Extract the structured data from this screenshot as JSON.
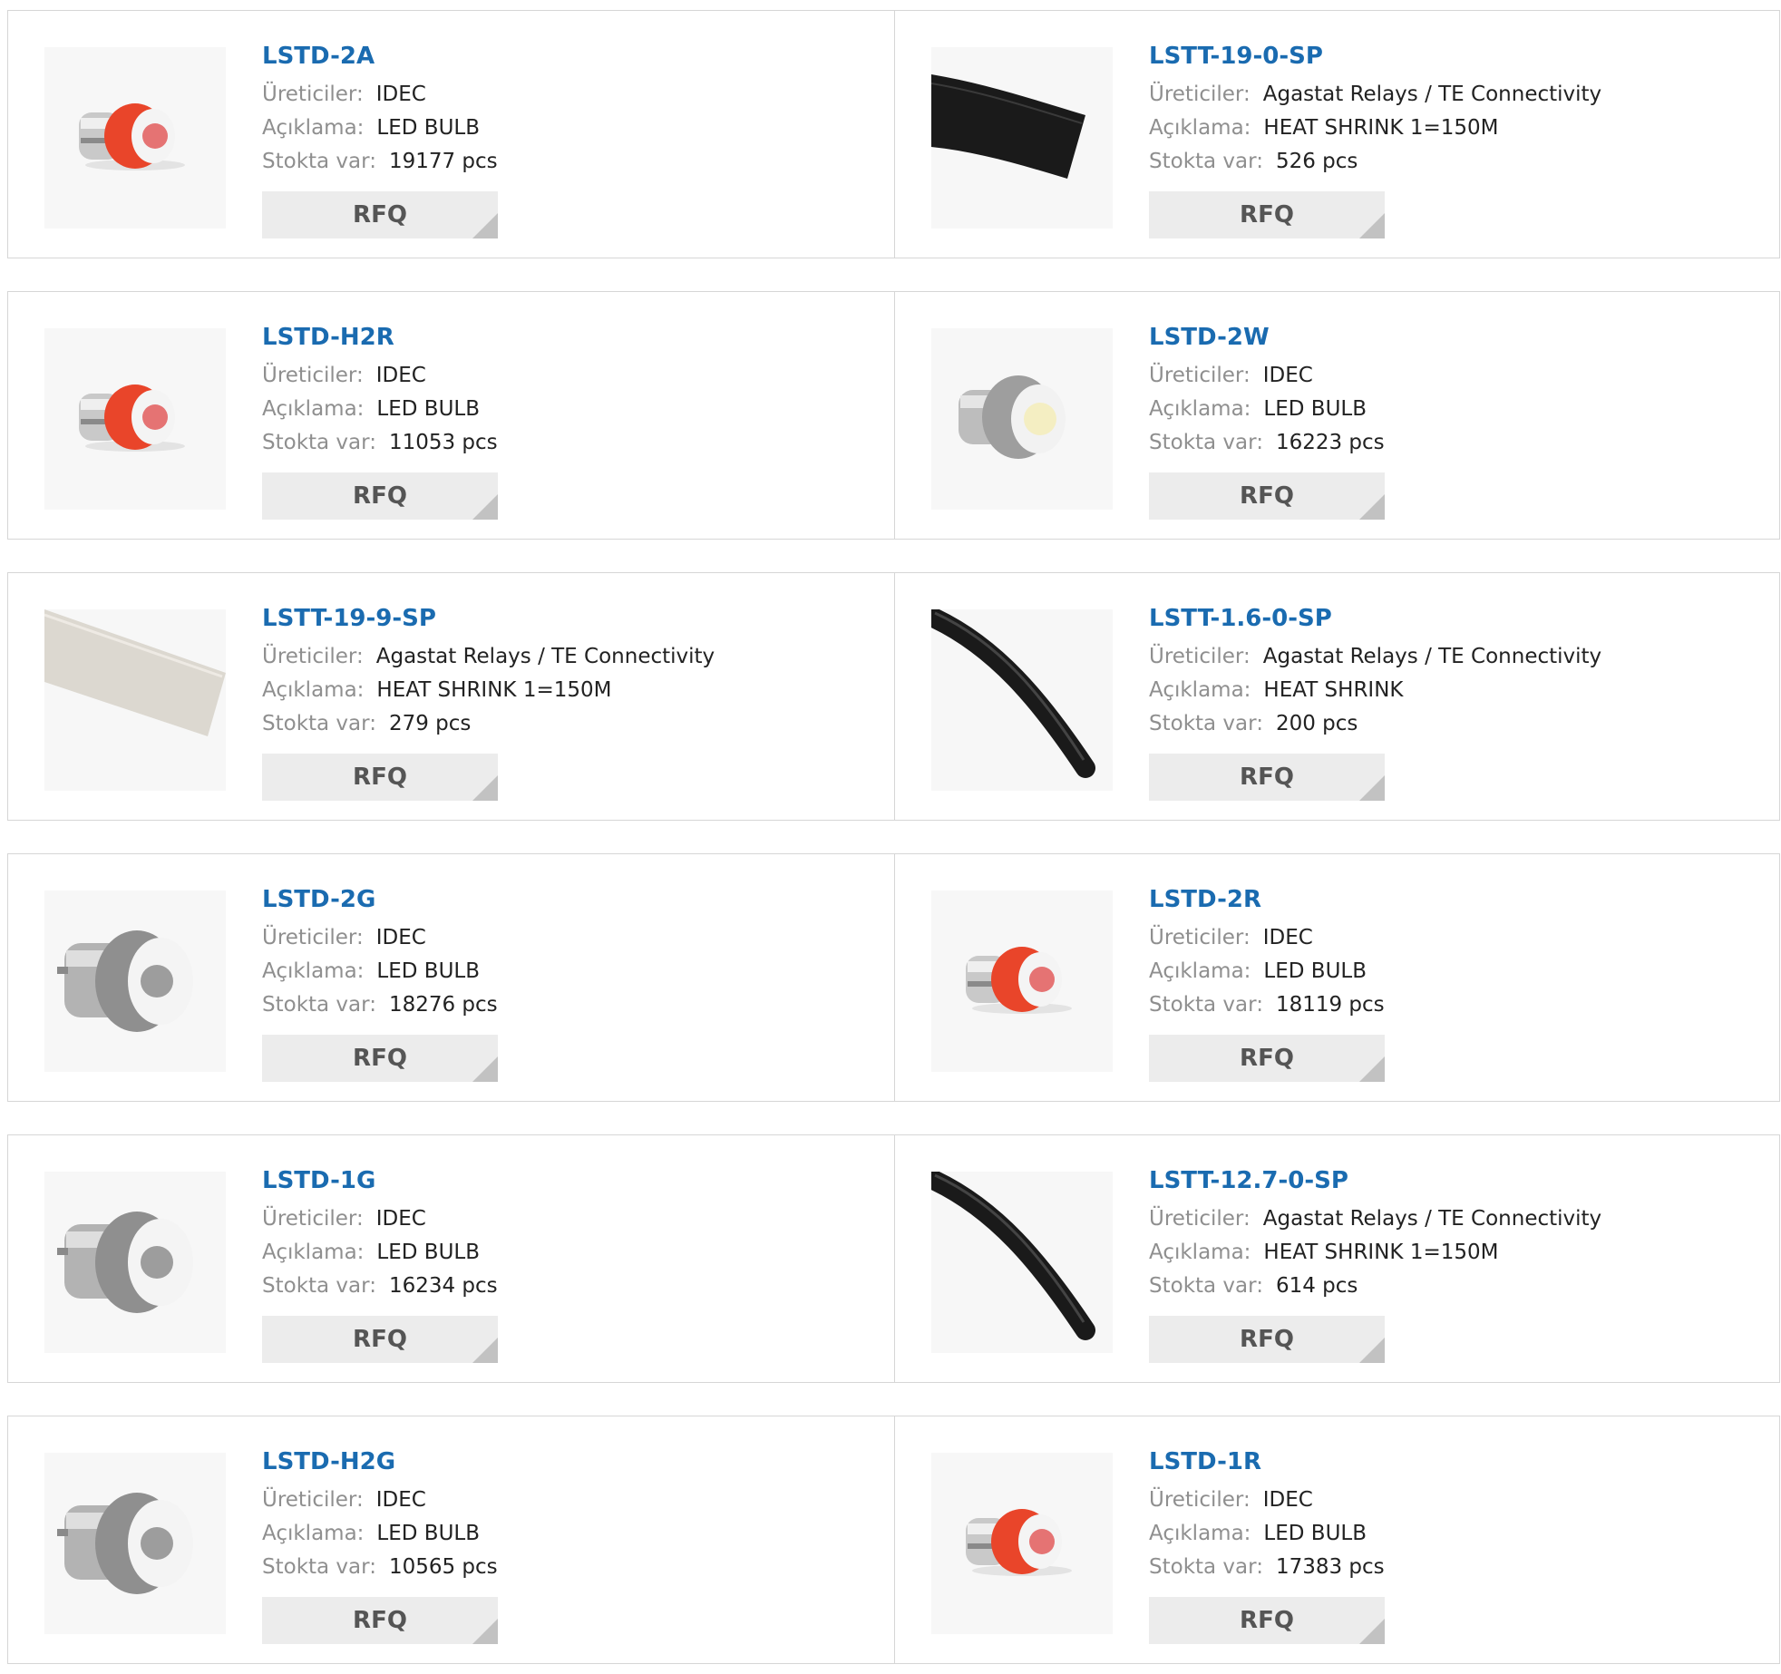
{
  "labels": {
    "manufacturer": "Üreticiler:",
    "description": "Açıklama:",
    "stock": "Stokta var:",
    "rfq": "RFQ"
  },
  "products": [
    {
      "part": "LSTD-2A",
      "manufacturer": "IDEC",
      "description": "LED BULB",
      "stock": "19177 pcs",
      "image": "bulb-red-icon"
    },
    {
      "part": "LSTT-19-0-SP",
      "manufacturer": "Agastat Relays / TE Connectivity",
      "description": "HEAT SHRINK 1=150M",
      "stock": "526 pcs",
      "image": "heat-shrink-black-flat-icon"
    },
    {
      "part": "LSTD-H2R",
      "manufacturer": "IDEC",
      "description": "LED BULB",
      "stock": "11053 pcs",
      "image": "bulb-red-icon"
    },
    {
      "part": "LSTD-2W",
      "manufacturer": "IDEC",
      "description": "LED BULB",
      "stock": "16223 pcs",
      "image": "bulb-white-icon"
    },
    {
      "part": "LSTT-19-9-SP",
      "manufacturer": "Agastat Relays / TE Connectivity",
      "description": "HEAT SHRINK 1=150M",
      "stock": "279 pcs",
      "image": "heat-shrink-clear-icon"
    },
    {
      "part": "LSTT-1.6-0-SP",
      "manufacturer": "Agastat Relays / TE Connectivity",
      "description": "HEAT SHRINK",
      "stock": "200 pcs",
      "image": "heat-shrink-black-tube-icon"
    },
    {
      "part": "LSTD-2G",
      "manufacturer": "IDEC",
      "description": "LED BULB",
      "stock": "18276 pcs",
      "image": "bulb-gray-icon"
    },
    {
      "part": "LSTD-2R",
      "manufacturer": "IDEC",
      "description": "LED BULB",
      "stock": "18119 pcs",
      "image": "bulb-red-icon"
    },
    {
      "part": "LSTD-1G",
      "manufacturer": "IDEC",
      "description": "LED BULB",
      "stock": "16234 pcs",
      "image": "bulb-gray-icon"
    },
    {
      "part": "LSTT-12.7-0-SP",
      "manufacturer": "Agastat Relays / TE Connectivity",
      "description": "HEAT SHRINK 1=150M",
      "stock": "614 pcs",
      "image": "heat-shrink-black-tube-icon"
    },
    {
      "part": "LSTD-H2G",
      "manufacturer": "IDEC",
      "description": "LED BULB",
      "stock": "10565 pcs",
      "image": "bulb-gray-icon"
    },
    {
      "part": "LSTD-1R",
      "manufacturer": "IDEC",
      "description": "LED BULB",
      "stock": "17383 pcs",
      "image": "bulb-red-icon"
    }
  ],
  "colors": {
    "part_link": "#1a6bb0",
    "label": "#8f8f8f",
    "value": "#222222",
    "button_bg": "#ececec",
    "button_text": "#555555",
    "border": "#d6d6d6"
  }
}
